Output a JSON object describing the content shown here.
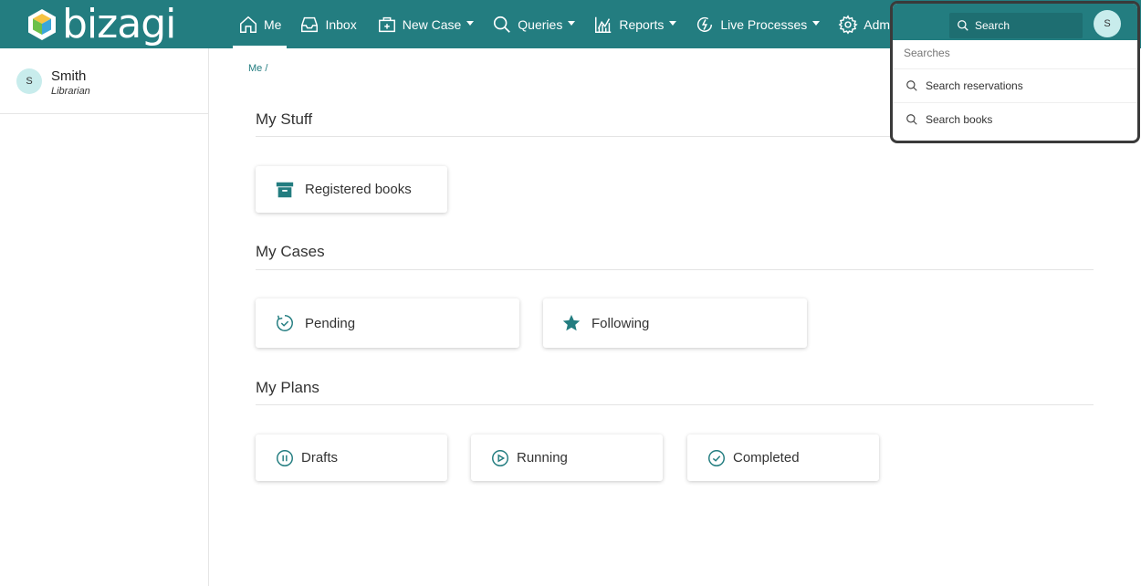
{
  "brand": {
    "name": "bizagi"
  },
  "nav": {
    "me": "Me",
    "inbox": "Inbox",
    "new_case": "New Case",
    "queries": "Queries",
    "reports": "Reports",
    "live_processes": "Live Processes",
    "admin": "Admin"
  },
  "user": {
    "initial": "S",
    "name": "Smith",
    "role": "Librarian"
  },
  "breadcrumb": "Me /",
  "sections": {
    "my_stuff": {
      "title": "My Stuff",
      "cards": {
        "registered_books": "Registered books"
      }
    },
    "my_cases": {
      "title": "My Cases",
      "cards": {
        "pending": "Pending",
        "following": "Following"
      }
    },
    "my_plans": {
      "title": "My Plans",
      "cards": {
        "drafts": "Drafts",
        "running": "Running",
        "completed": "Completed"
      }
    }
  },
  "search": {
    "placeholder": "Search",
    "header_label": "Searches",
    "items": [
      "Search reservations",
      "Search books"
    ]
  },
  "colors": {
    "brand": "#237d80",
    "avatar_bg": "#c8ecec"
  },
  "icons": [
    "home-icon",
    "inbox-icon",
    "new-case-icon",
    "search-icon",
    "reports-icon",
    "live-processes-icon",
    "gear-icon",
    "archive-icon",
    "clock-icon",
    "star-icon",
    "pause-icon",
    "play-icon",
    "check-icon"
  ]
}
